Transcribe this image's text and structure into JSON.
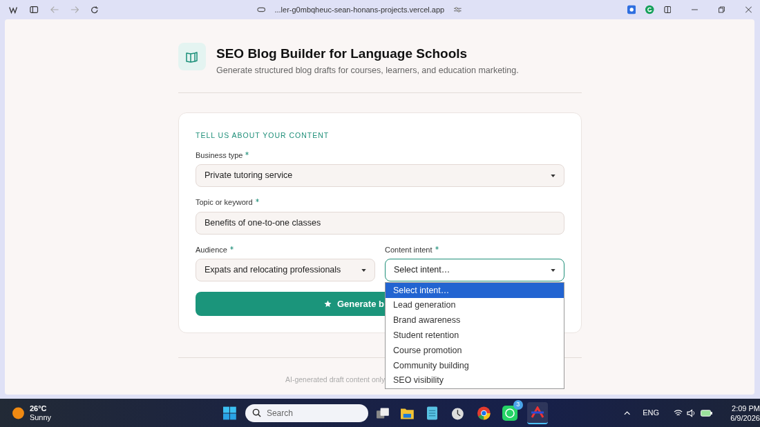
{
  "browser": {
    "url": "...ler-g0mbqheuc-sean-honans-projects.vercel.app"
  },
  "header": {
    "title": "SEO Blog Builder for Language Schools",
    "subtitle": "Generate structured blog drafts for courses, learners, and education marketing."
  },
  "form": {
    "section_label": "TELL US ABOUT YOUR CONTENT",
    "fields": [
      {
        "kind": "select",
        "label": "Business type",
        "required": true,
        "value": "Private tutoring service",
        "focused": false
      },
      {
        "kind": "text",
        "label": "Topic or keyword",
        "required": true,
        "value": "Benefits of one-to-one classes",
        "focused": false
      },
      {
        "kind": "select",
        "label": "Audience",
        "required": true,
        "value": "Expats and relocating professionals",
        "focused": false
      },
      {
        "kind": "select",
        "label": "Content intent",
        "required": true,
        "placeholder": "Select intent…",
        "focused": true
      }
    ],
    "submit": "Generate b"
  },
  "footer": {
    "note": "AI-generated draft content only"
  },
  "dropdown": {
    "options": [
      {
        "label": "Select intent…",
        "selected": true
      },
      {
        "label": "Lead generation",
        "selected": false
      },
      {
        "label": "Brand awareness",
        "selected": false
      },
      {
        "label": "Student retention",
        "selected": false
      },
      {
        "label": "Course promotion",
        "selected": false
      },
      {
        "label": "Community building",
        "selected": false
      },
      {
        "label": "SEO visibility",
        "selected": false
      }
    ]
  },
  "taskbar": {
    "weather": {
      "temp": "26°C",
      "condition": "Sunny"
    },
    "search_placeholder": "Search",
    "whatsapp_badge": "3",
    "language": "ENG",
    "time": "2:09 PM",
    "date": "6/9/2026"
  }
}
